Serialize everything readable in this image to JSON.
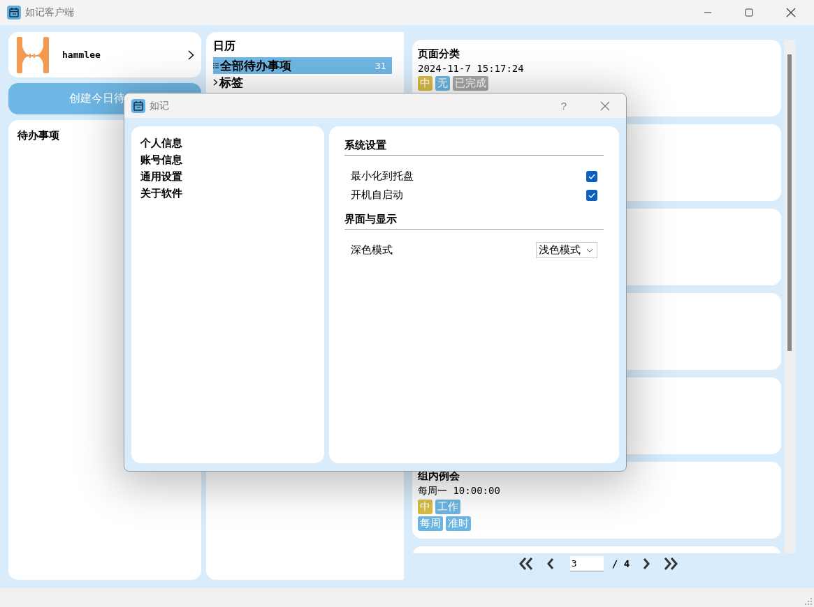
{
  "window": {
    "title": "如记客户端"
  },
  "profile": {
    "name": "hammlee"
  },
  "create_button": {
    "label": "创建今日待"
  },
  "todo_panel": {
    "title": "待办事项"
  },
  "nav": {
    "title": "日历",
    "items": [
      {
        "kind": "list",
        "label": "全部待办事项",
        "count": "31",
        "selected": true
      },
      {
        "kind": "group",
        "label": "标签",
        "selected": false
      }
    ]
  },
  "tasks": [
    {
      "kind": "task",
      "title": "页面分类",
      "time": "2024-11-7 15:17:24",
      "tag_rows": [
        [
          {
            "label": "中",
            "color": "#d8be44"
          },
          {
            "label": "无",
            "color": "#6cb6e2"
          },
          {
            "label": "已完成",
            "color": "#a6a6a6"
          }
        ]
      ]
    },
    {
      "kind": "covered"
    },
    {
      "kind": "covered"
    },
    {
      "kind": "covered"
    },
    {
      "kind": "covered"
    },
    {
      "kind": "task",
      "title": "组内例会",
      "time": "每周一 10:00:00",
      "tag_rows": [
        [
          {
            "label": "中",
            "color": "#d8be44"
          },
          {
            "label": "工作",
            "color": "#6cb6e2"
          }
        ],
        [
          {
            "label": "每周",
            "color": "#6cb6e2"
          },
          {
            "label": "准时",
            "color": "#6cb6e2"
          }
        ]
      ]
    },
    {
      "kind": "covered"
    }
  ],
  "pagination": {
    "page": "3",
    "total": "/ 4"
  },
  "dialog": {
    "title": "如记",
    "help": "?",
    "nav": [
      "个人信息",
      "账号信息",
      "通用设置",
      "关于软件"
    ],
    "sections": [
      {
        "title": "系统设置",
        "rows": [
          {
            "kind": "checkbox",
            "label": "最小化到托盘",
            "checked": true
          },
          {
            "kind": "checkbox",
            "label": "开机自启动",
            "checked": true
          }
        ]
      },
      {
        "title": "界面与显示",
        "rows": [
          {
            "kind": "select",
            "label": "深色模式",
            "value": "浅色模式"
          }
        ]
      }
    ]
  }
}
